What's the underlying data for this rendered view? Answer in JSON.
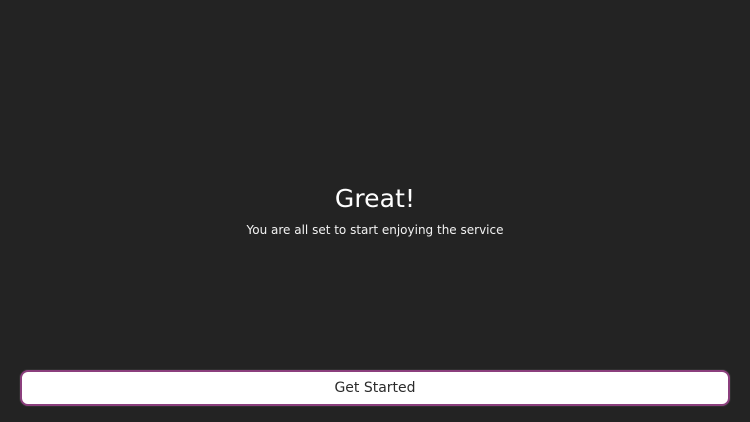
{
  "screen": {
    "title": "Great!",
    "subtitle": "You are all set to start enjoying the service",
    "button_label": "Get Started"
  },
  "colors": {
    "background": "#232323",
    "text": "#ffffff",
    "button_background": "#ffffff",
    "button_border": "#8b3f7d",
    "button_text": "#2b2b2b"
  }
}
